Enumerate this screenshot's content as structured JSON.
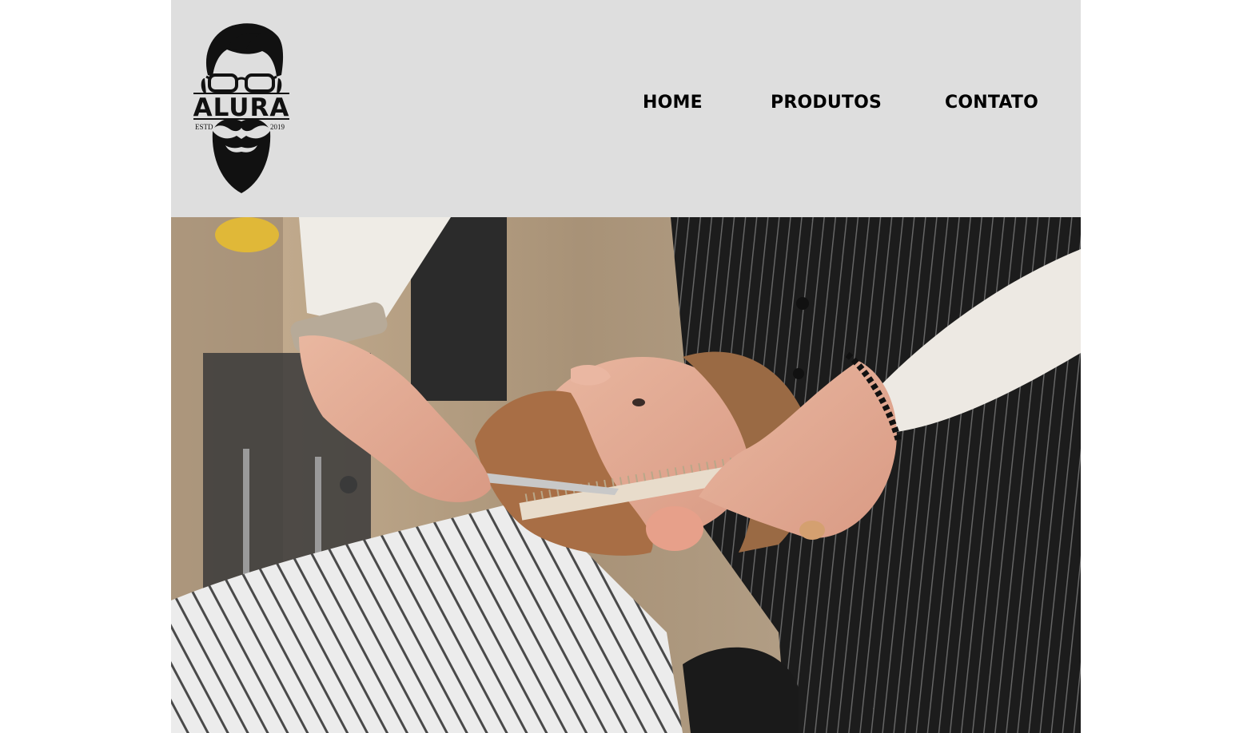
{
  "header": {
    "logo": {
      "brand": "ALURA",
      "left_text": "ESTD",
      "right_text": "2019"
    },
    "nav": [
      {
        "label": "HOME"
      },
      {
        "label": "PRODUTOS"
      },
      {
        "label": "CONTATO"
      }
    ]
  },
  "colors": {
    "header_bg": "#dedede",
    "nav_text": "#000000"
  }
}
